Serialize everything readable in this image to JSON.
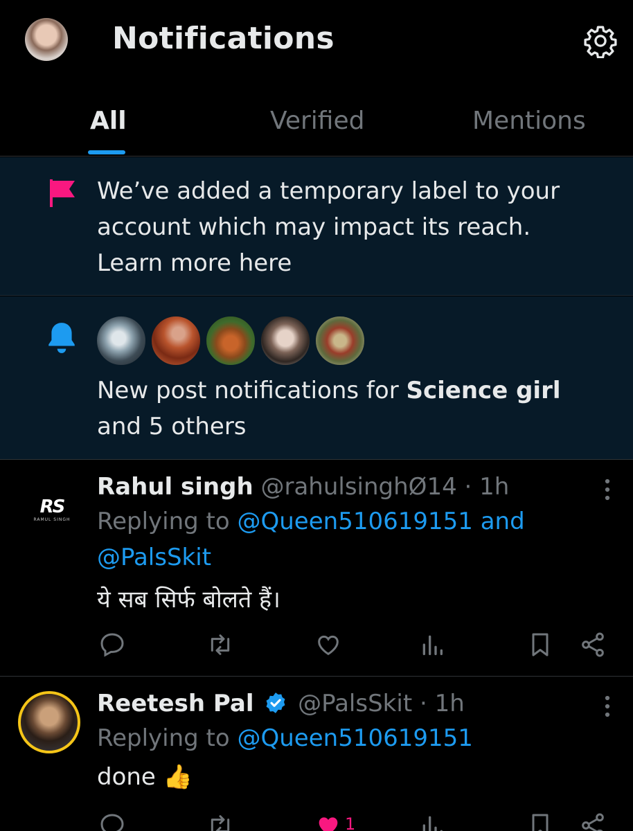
{
  "header": {
    "title": "Notifications"
  },
  "tabs": [
    {
      "label": "All",
      "active": true
    },
    {
      "label": "Verified",
      "active": false
    },
    {
      "label": "Mentions",
      "active": false
    }
  ],
  "notice": {
    "text": "We’ve added a temporary label to your account which may impact its reach. Learn more here",
    "icon": "flag-icon",
    "icon_color": "#f91880"
  },
  "post_notifications": {
    "icon": "bell-icon",
    "icon_color": "#1d9bf0",
    "text_prefix": "New post notifications for ",
    "bold_name": "Science girl",
    "text_suffix": " and 5 others"
  },
  "tweets": [
    {
      "name": "Rahul singh",
      "handle": "@rahulsinghØ14",
      "time": " · 1h",
      "reply_prefix": "Replying to ",
      "reply_to": "@Queen510619151 and @PalsSkit",
      "body": "ये सब सिर्फ बोलते हैं।",
      "avatar_logo": "RS",
      "avatar_sub": "RAMUL SINGH",
      "verified": false
    },
    {
      "name": "Reetesh Pal",
      "handle": "@PalsSkit",
      "time": " · 1h",
      "reply_prefix": "Replying to ",
      "reply_to": "@Queen510619151",
      "body": "done 👍",
      "verified": true,
      "like_count": "1",
      "liked": true
    }
  ],
  "colors": {
    "accent": "#1d9bf0",
    "like": "#f91880",
    "muted": "#71767b"
  }
}
